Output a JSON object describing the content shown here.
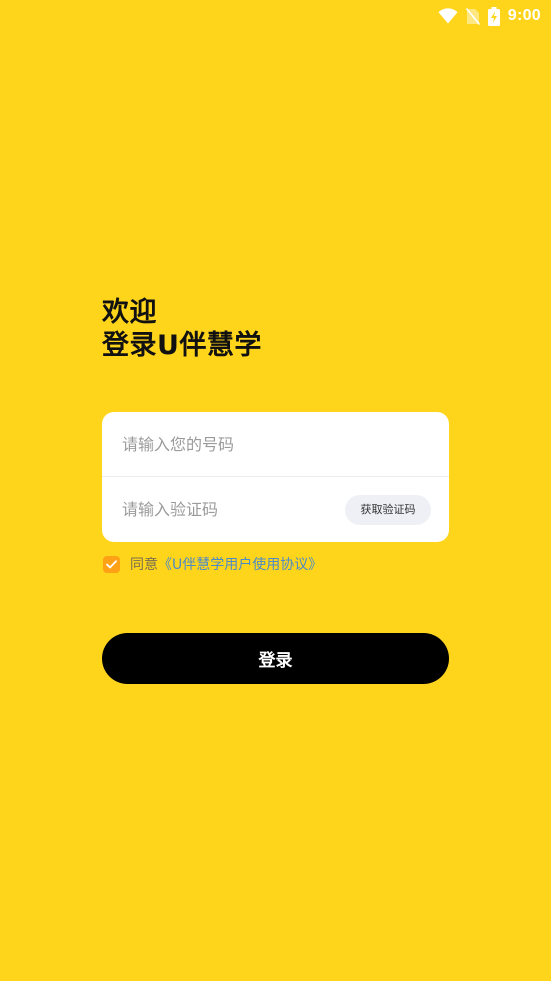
{
  "status_bar": {
    "time": "9:00",
    "icons": [
      "wifi-icon",
      "no-sim-icon",
      "battery-charging-icon"
    ]
  },
  "welcome": {
    "line1": "欢迎",
    "line2": "登录U伴慧学"
  },
  "form": {
    "phone": {
      "value": "",
      "placeholder": "请输入您的号码"
    },
    "code": {
      "value": "",
      "placeholder": "请输入验证码"
    },
    "get_code_label": "获取验证码"
  },
  "agreement": {
    "checked": true,
    "prefix": "同意",
    "link": "《U伴慧学用户使用协议》"
  },
  "login_label": "登录",
  "colors": {
    "background": "#FFD51C",
    "card": "#FFFFFF",
    "button": "#000000",
    "checkbox": "#FFA114",
    "link": "#4C8BC8",
    "code_button": "#EFF0F6"
  }
}
